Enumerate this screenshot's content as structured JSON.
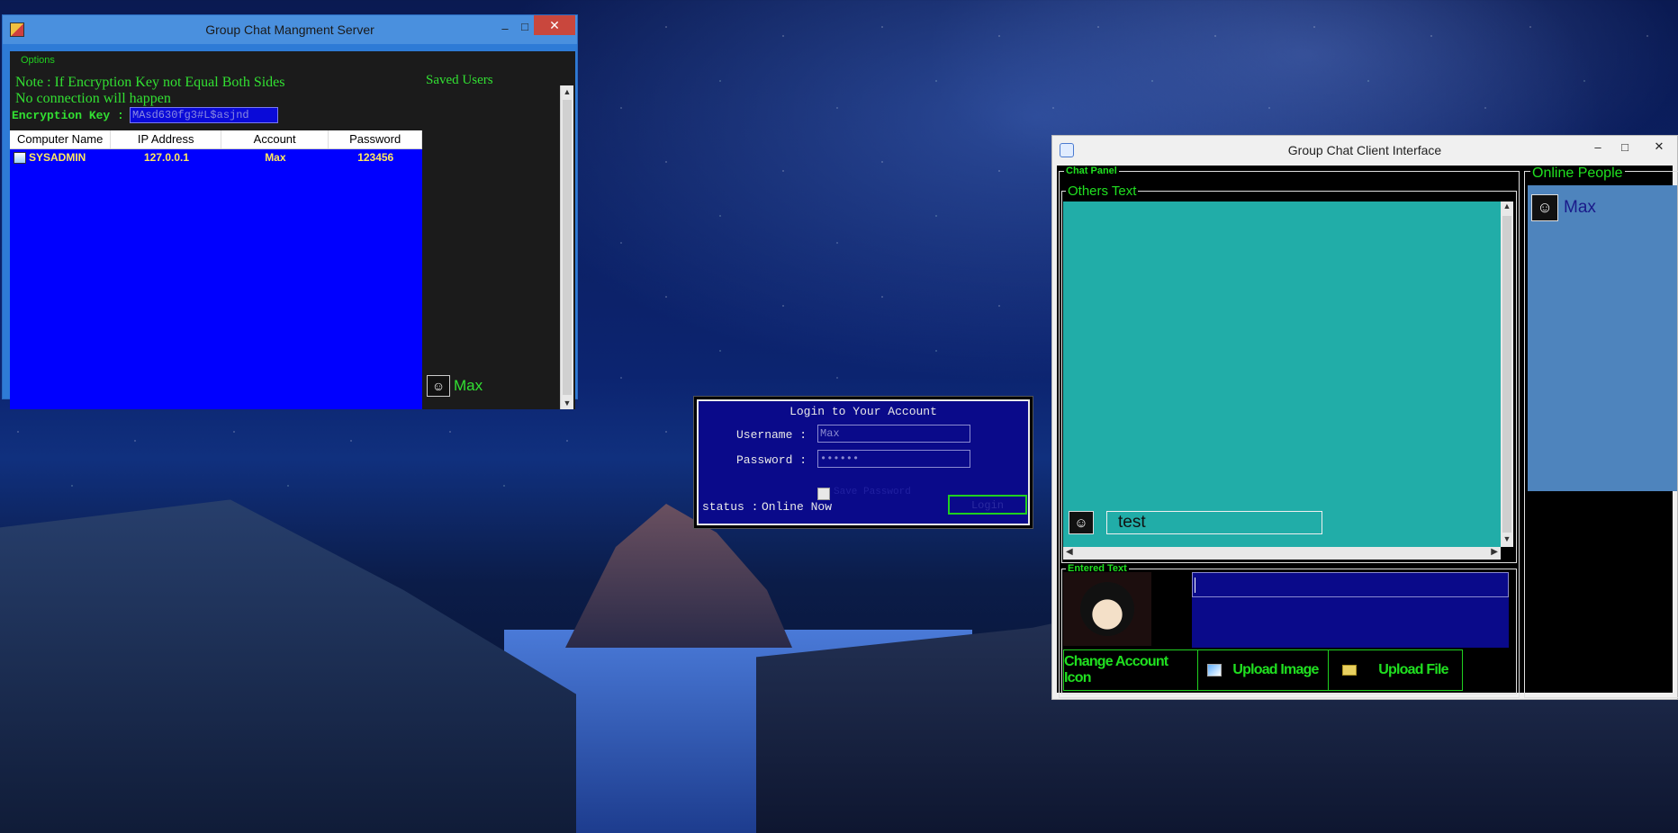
{
  "server": {
    "title": "Group Chat Mangment Server",
    "menu_options": "Options",
    "note_line1": "Note : If Encryption Key not Equal Both Sides",
    "note_line2": "No connection will happen",
    "encryption_label": "Encryption Key  :",
    "encryption_value": "MAsd630fg3#L$asjnd",
    "columns": [
      "Computer Name",
      "IP Address",
      "Account",
      "Password"
    ],
    "rows": [
      {
        "computer": "SYSADMIN",
        "ip": "127.0.0.1",
        "account": "Max",
        "password": "123456"
      }
    ],
    "saved_users_title": "Saved Users",
    "saved_users": [
      {
        "name": "Max"
      }
    ]
  },
  "login": {
    "title": "Login to Your Account",
    "username_label": "Username :",
    "username_value": "Max",
    "password_label": "Password :",
    "password_value": "••••••",
    "remember_label": "Save Password",
    "button_label": "Login",
    "status_label": "status :",
    "status_value": "Online Now"
  },
  "client": {
    "title": "Group Chat Client Interface",
    "chat_panel_label": "Chat Panel",
    "others_text_label": "Others Text",
    "messages": [
      {
        "text": "test"
      }
    ],
    "entered_text_label": "Entered Text",
    "buttons": {
      "change_icon": "Change Account Icon",
      "upload_image": "Upload Image",
      "upload_file": "Upload File"
    },
    "online_people_label": "Online People",
    "online_people": [
      {
        "name": "Max"
      }
    ]
  },
  "window_controls": {
    "minimize": "–",
    "maximize": "□",
    "close": "✕"
  },
  "colors": {
    "server_list_bg": "#0000ff",
    "accent_green": "#32e032",
    "chat_bg": "#21ada8",
    "login_bg": "#0a0a8a",
    "online_bg": "#4e84bd"
  }
}
